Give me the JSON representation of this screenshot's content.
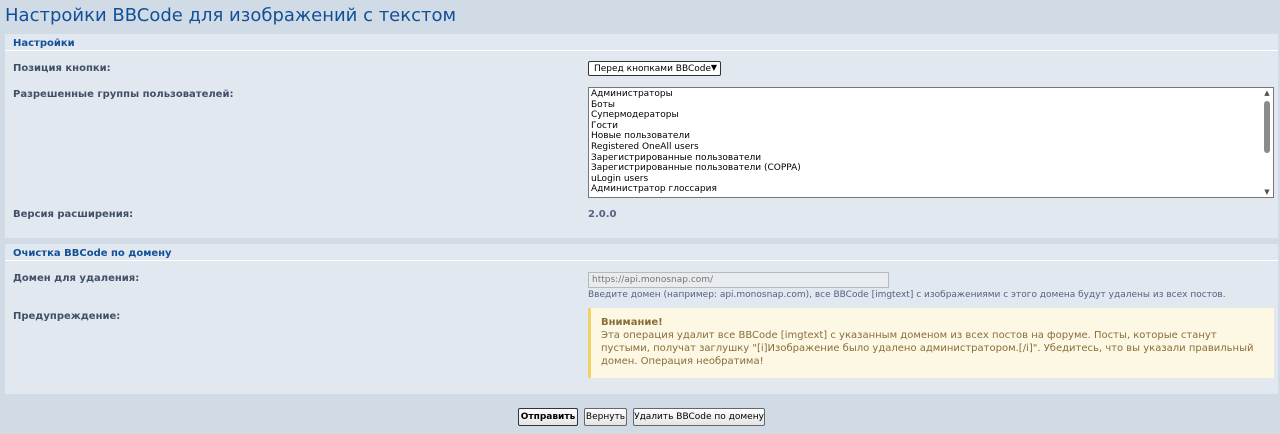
{
  "page": {
    "title": "Настройки BBCode для изображений с текстом"
  },
  "settings": {
    "legend": "Настройки",
    "button_position_label": "Позиция кнопки:",
    "button_position_value": "Перед кнопками BBCode",
    "groups_label": "Разрешенные группы пользователей:",
    "groups": [
      "Администраторы",
      "Боты",
      "Супермодераторы",
      "Гости",
      "Новые пользователи",
      "Registered OneAll users",
      "Зарегистрированные пользователи",
      "Зарегистрированные пользователи (COPPA)",
      "uLogin users",
      "Администратор глоссария"
    ],
    "version_label": "Версия расширения:",
    "version_value": "2.0.0"
  },
  "cleanup": {
    "legend": "Очистка BBCode по домену",
    "domain_label": "Домен для удаления:",
    "domain_placeholder": "https://api.monosnap.com/",
    "domain_hint": "Введите домен (например: api.monosnap.com), все BBCode [imgtext] с изображениями с этого домена будут удалены из всех постов.",
    "warning_label": "Предупреждение:",
    "warning_title": "Внимание!",
    "warning_text": "Эта операция удалит все BBCode [imgtext] с указанным доменом из всех постов на форуме. Посты, которые станут пустыми, получат заглушку \"[i]Изображение было удалено администратором.[/i]\". Убедитесь, что вы указали правильный домен. Операция необратима!"
  },
  "buttons": {
    "submit": "Отправить",
    "reset": "Вернуть",
    "delete_by_domain": "Удалить BBCode по домену"
  },
  "icons": {
    "select_arrow": "chevron-down-icon",
    "scroll_up": "arrow-up-icon",
    "scroll_down": "arrow-down-icon"
  }
}
